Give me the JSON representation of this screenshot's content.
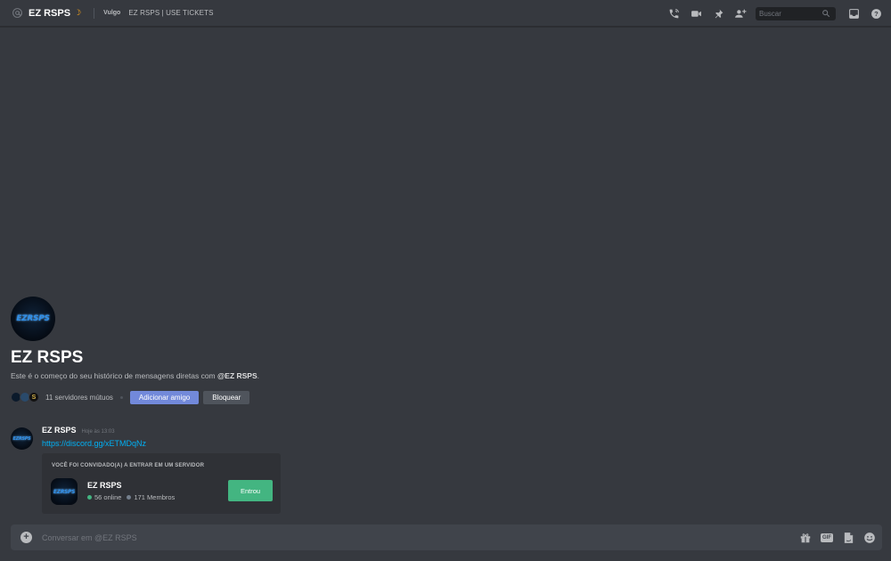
{
  "header": {
    "title": "EZ RSPS",
    "nickname": "Vulgo",
    "status": "EZ RSPS | USE TICKETS",
    "search_placeholder": "Buscar",
    "icons": [
      "at-icon",
      "moon-icon",
      "call-icon",
      "video-icon",
      "pin-icon",
      "add-friend-icon",
      "search-icon",
      "inbox-icon",
      "help-icon"
    ]
  },
  "avatar": {
    "logo_text": "EZRSPS"
  },
  "intro": {
    "name": "EZ RSPS",
    "description_prefix": "Este é o começo do seu histórico de mensagens diretas com ",
    "description_mention": "@EZ RSPS",
    "description_suffix": ".",
    "mutual_servers": "11 servidores mútuos",
    "mutual_avatar_letters": [
      "",
      "",
      "S"
    ],
    "add_friend_label": "Adicionar amigo",
    "block_label": "Bloquear"
  },
  "message": {
    "author": "EZ RSPS",
    "timestamp": "Hoje às 13:03",
    "link": "https://discord.gg/xETMDqNz"
  },
  "invite": {
    "label": "VOCÊ FOI CONVIDADO(A) A ENTRAR EM UM SERVIDOR",
    "server_name": "EZ RSPS",
    "online": "56 online",
    "members": "171 Membros",
    "join_label": "Entrou"
  },
  "composer": {
    "placeholder": "Conversar em @EZ RSPS",
    "gif_label": "GIF"
  },
  "colors": {
    "background": "#36393f",
    "accent": "#7289da",
    "link": "#00b0f4",
    "online": "#43b581",
    "members": "#747f8d",
    "join": "#43b581"
  }
}
